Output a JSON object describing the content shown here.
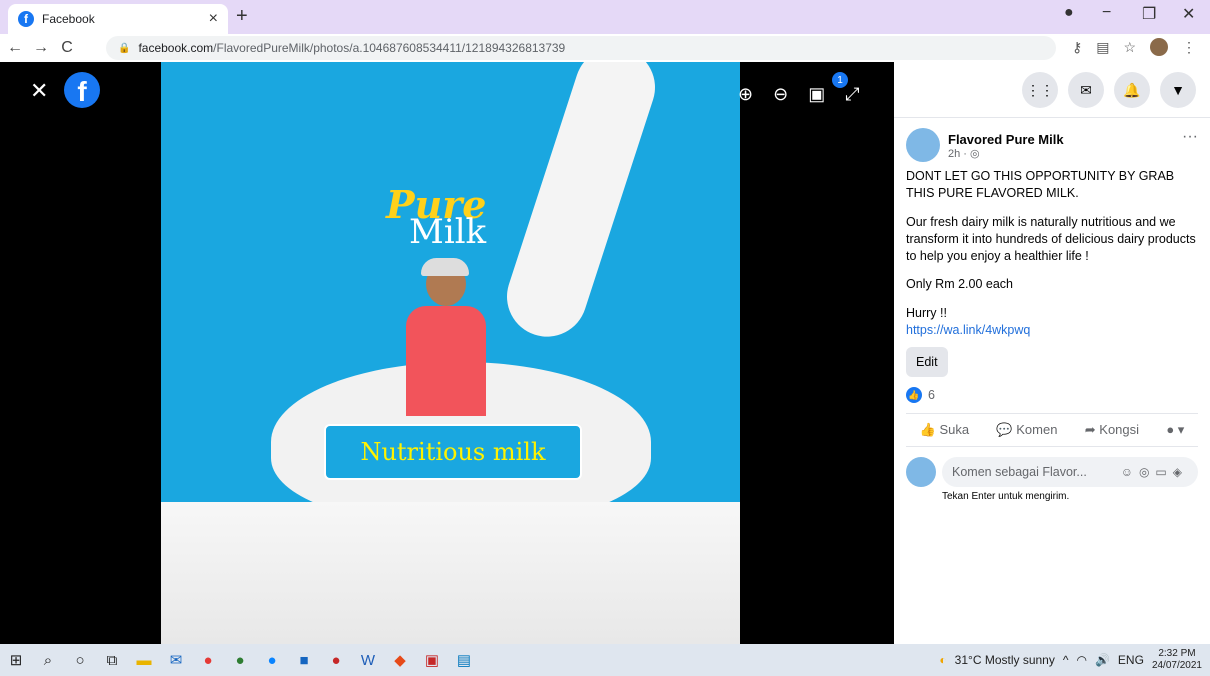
{
  "browser": {
    "tab_title": "Facebook",
    "url_domain": "facebook.com",
    "url_path": "/FlavoredPureMilk/photos/a.104687608534411/121894326813739"
  },
  "viewer": {
    "photo_text_pure": "Pure",
    "photo_text_milk": "Milk",
    "photo_banner": "Nutritious milk",
    "notification_count": "1"
  },
  "post": {
    "page_name": "Flavored Pure Milk",
    "time": "2h ·",
    "line1": "DONT LET GO THIS OPPORTUNITY BY GRAB THIS PURE FLAVORED MILK.",
    "line2": "Our fresh dairy milk is naturally nutritious and we transform it into hundreds of delicious dairy products to help you enjoy a healthier life !",
    "line3": "Only Rm 2.00 each",
    "line4": "Hurry !!",
    "link": "https://wa.link/4wkpwq",
    "edit_label": "Edit",
    "like_count": "6",
    "action_like": "Suka",
    "action_comment": "Komen",
    "action_share": "Kongsi",
    "comment_placeholder": "Komen sebagai Flavor...",
    "comment_hint": "Tekan Enter untuk mengirim."
  },
  "taskbar": {
    "weather": "31°C Mostly sunny",
    "lang": "ENG",
    "time": "2:32 PM",
    "date": "24/07/2021"
  }
}
